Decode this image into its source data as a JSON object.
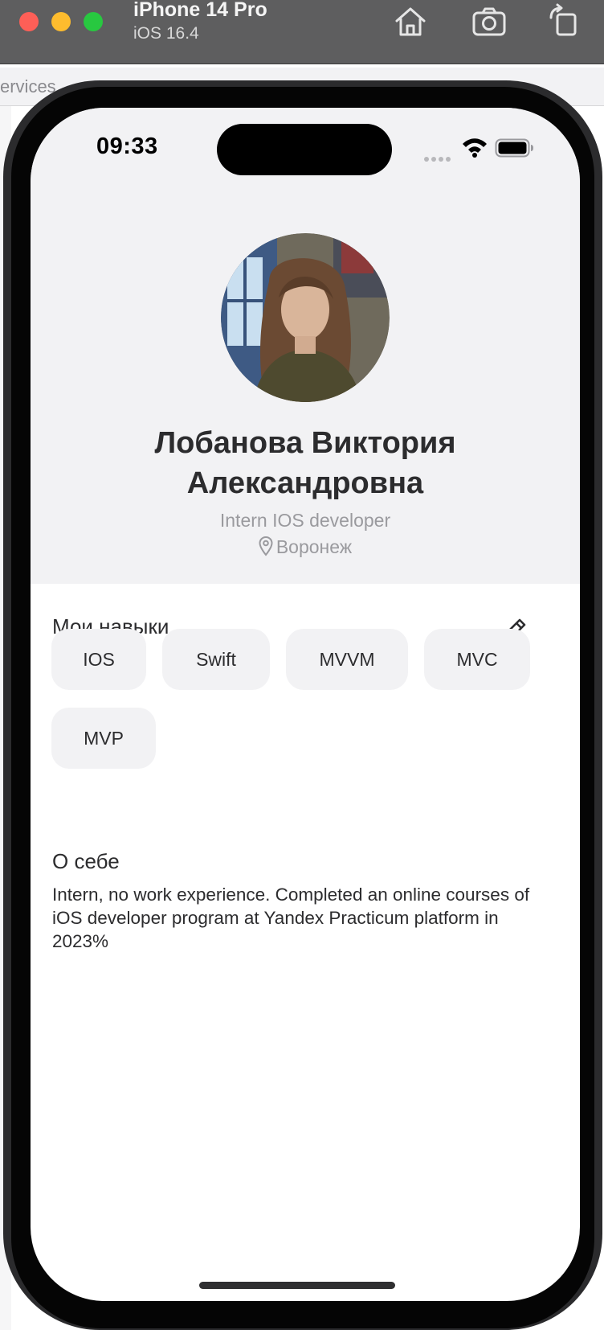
{
  "simulator": {
    "device_name": "iPhone 14 Pro",
    "os_version": "iOS 16.4",
    "toolbar": {
      "home_icon": "home-icon",
      "screenshot_icon": "camera-icon",
      "rotate_icon": "rotate-icon"
    }
  },
  "background": {
    "breadcrumb_fragment": "ervices"
  },
  "status_bar": {
    "time": "09:33",
    "icons": [
      "signal-dots-icon",
      "wifi-icon",
      "battery-icon"
    ]
  },
  "profile": {
    "avatar_icon": "avatar-photo",
    "full_name": "Лобанова Виктория Александровна",
    "position": "Intern IOS developer",
    "location": "Воронеж",
    "location_icon": "map-pin-icon"
  },
  "skills": {
    "title": "Мои навыки",
    "edit_icon": "pencil-icon",
    "items": [
      "IOS",
      "Swift",
      "MVVM",
      "MVC",
      "MVP"
    ]
  },
  "about": {
    "title": "О себе",
    "text": "Intern, no work experience. Completed an online courses of iOS developer program at Yandex Practicum platform in 2023%"
  },
  "colors": {
    "header_background": "#f2f2f4",
    "chip_background": "#f2f2f4",
    "primary_text": "#2c2c2e",
    "secondary_text": "#9a9a9e"
  }
}
